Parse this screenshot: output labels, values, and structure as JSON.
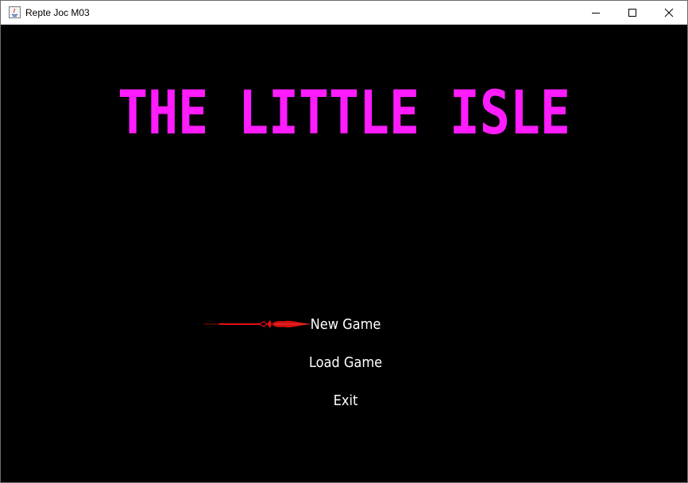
{
  "window": {
    "title": "Repte Joc M03"
  },
  "game": {
    "title": "THE LITTLE ISLE",
    "title_color": "#ff1cff",
    "background_color": "#000000",
    "menu": [
      {
        "label": "New Game",
        "selected": true
      },
      {
        "label": "Load Game",
        "selected": false
      },
      {
        "label": "Exit",
        "selected": false
      }
    ],
    "selector_icon": "red-sword-icon",
    "selector_color": "#e01010"
  }
}
